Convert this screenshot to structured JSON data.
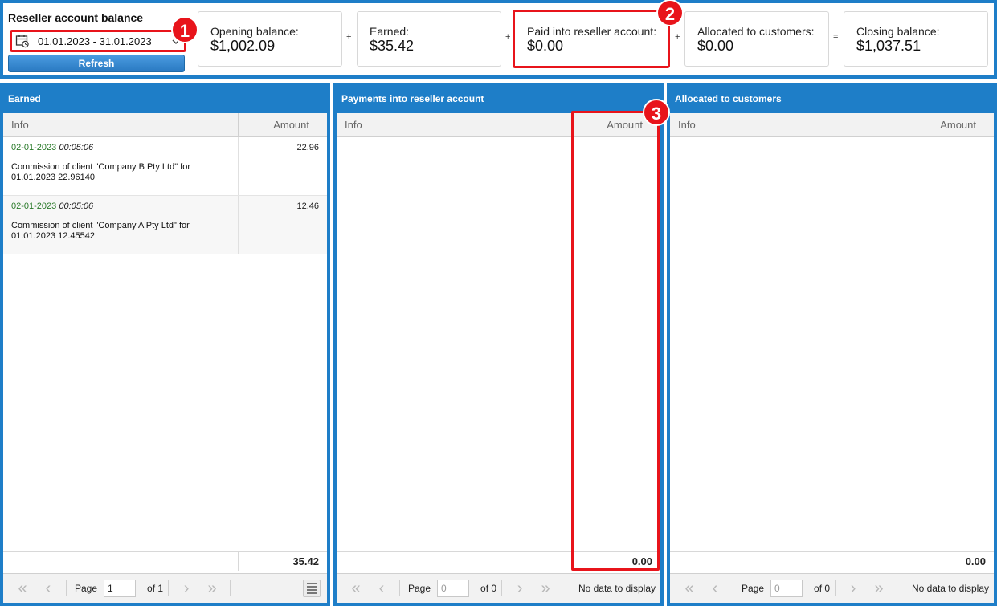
{
  "header": {
    "title": "Reseller account balance",
    "date_range": "01.01.2023 - 31.01.2023",
    "refresh_label": "Refresh"
  },
  "summary": [
    {
      "label": "Opening balance:",
      "value": "$1,002.09"
    },
    {
      "label": "Earned:",
      "value": "$35.42"
    },
    {
      "label": "Paid into reseller account:",
      "value": "$0.00"
    },
    {
      "label": "Allocated to customers:",
      "value": "$0.00"
    },
    {
      "label": "Closing balance:",
      "value": "$1,037.51"
    }
  ],
  "operators": [
    "+",
    "+",
    "+",
    "="
  ],
  "badges": [
    "1",
    "2",
    "3"
  ],
  "columns": {
    "info": "Info",
    "amount": "Amount"
  },
  "panels": {
    "earned": {
      "title": "Earned",
      "rows": [
        {
          "date": "02-01-2023",
          "time": "00:05:06",
          "desc": "Commission of client \"Company B Pty Ltd\" for 01.01.2023 22.96140",
          "amount": "22.96"
        },
        {
          "date": "02-01-2023",
          "time": "00:05:06",
          "desc": "Commission of client \"Company A Pty Ltd\" for 01.01.2023 12.45542",
          "amount": "12.46"
        }
      ],
      "total": "35.42",
      "pager": {
        "page_label": "Page",
        "page_value": "1",
        "of_label": "of 1"
      }
    },
    "payments": {
      "title": "Payments into reseller account",
      "rows": [],
      "total": "0.00",
      "pager": {
        "page_label": "Page",
        "page_value": "0",
        "of_label": "of 0",
        "status": "No data to display"
      }
    },
    "allocated": {
      "title": "Allocated to customers",
      "rows": [],
      "total": "0.00",
      "pager": {
        "page_label": "Page",
        "page_value": "0",
        "of_label": "of 0",
        "status": "No data to display"
      }
    }
  },
  "colors": {
    "accent": "#1e7ec8",
    "highlight": "#e8141b",
    "date_green": "#2a7a2a"
  },
  "icons": [
    "calendar-icon",
    "chevron-down-icon",
    "first-page-icon",
    "prev-page-icon",
    "next-page-icon",
    "last-page-icon",
    "grid-menu-icon"
  ]
}
